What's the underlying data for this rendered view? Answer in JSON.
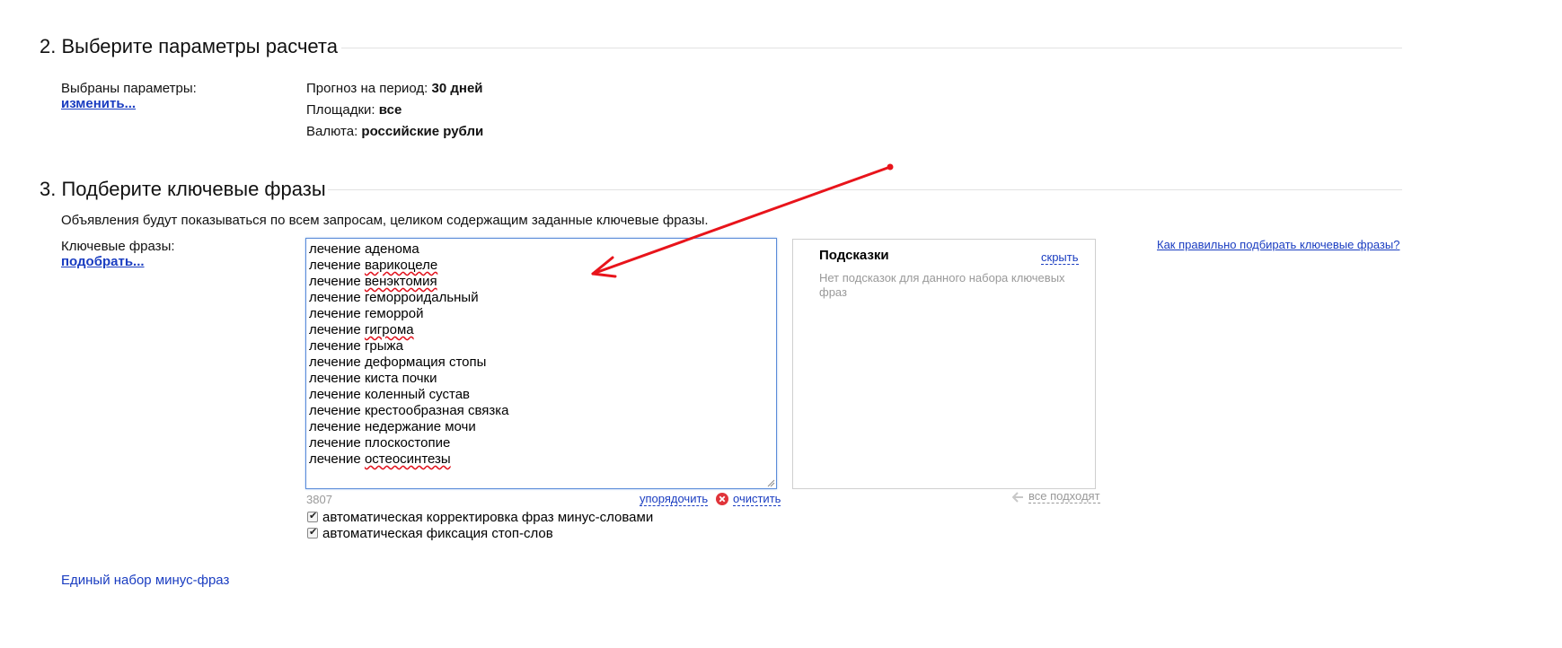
{
  "section2": {
    "title": "2. Выберите параметры расчета",
    "selected_label": "Выбраны параметры:",
    "change_link": "изменить...",
    "params": [
      {
        "label": "Прогноз на период: ",
        "value": "30 дней"
      },
      {
        "label": "Площадки: ",
        "value": "все"
      },
      {
        "label": "Валюта: ",
        "value": "российские рубли"
      }
    ]
  },
  "section3": {
    "title": "3. Подберите ключевые фразы",
    "description": "Объявления будут показываться по всем запросам, целиком содержащим заданные ключевые фразы.",
    "keywords_label": "Ключевые фразы:",
    "pick_link": "подобрать...",
    "keywords": [
      {
        "prefix": "лечение ",
        "word": "аденома",
        "misspelled": false
      },
      {
        "prefix": "лечение ",
        "word": "варикоцеле",
        "misspelled": true
      },
      {
        "prefix": "лечение ",
        "word": "венэктомия",
        "misspelled": true
      },
      {
        "prefix": "лечение ",
        "word": "геморроидальный",
        "misspelled": false
      },
      {
        "prefix": "лечение ",
        "word": "геморрой",
        "misspelled": false
      },
      {
        "prefix": "лечение ",
        "word": "гигрома",
        "misspelled": true
      },
      {
        "prefix": "лечение ",
        "word": "грыжа",
        "misspelled": false
      },
      {
        "prefix": "лечение ",
        "word": "деформация стопы",
        "misspelled": false
      },
      {
        "prefix": "лечение ",
        "word": "киста почки",
        "misspelled": false
      },
      {
        "prefix": "лечение ",
        "word": "коленный сустав",
        "misspelled": false
      },
      {
        "prefix": "лечение ",
        "word": "крестообразная связка",
        "misspelled": false
      },
      {
        "prefix": "лечение ",
        "word": "недержание мочи",
        "misspelled": false
      },
      {
        "prefix": "лечение ",
        "word": "плоскостопие",
        "misspelled": false
      },
      {
        "prefix": "лечение ",
        "word": "остеосинтезы",
        "misspelled": true
      }
    ],
    "char_count": "3807",
    "sort_link": "упорядочить",
    "clear_link": "очистить",
    "tips_title": "Подсказки",
    "hide_link": "скрыть",
    "tips_empty": "Нет подсказок для данного набора ключевых фраз",
    "all_fit": "все подходят",
    "help_link": "Как правильно подбирать ключевые фразы?",
    "checkboxes": [
      {
        "label": "автоматическая корректировка фраз минус-словами",
        "checked": true
      },
      {
        "label": "автоматическая фиксация стоп-слов",
        "checked": true
      }
    ],
    "minus_phrases_link": "Единый набор минус-фраз"
  },
  "colors": {
    "link": "#1a3dc1",
    "annotation_arrow": "#e8141b",
    "clear_icon": "#e0343a"
  },
  "icons": [
    "clear-x-icon",
    "left-arrow-icon",
    "resize-grip-icon",
    "checkbox-check-icon"
  ]
}
